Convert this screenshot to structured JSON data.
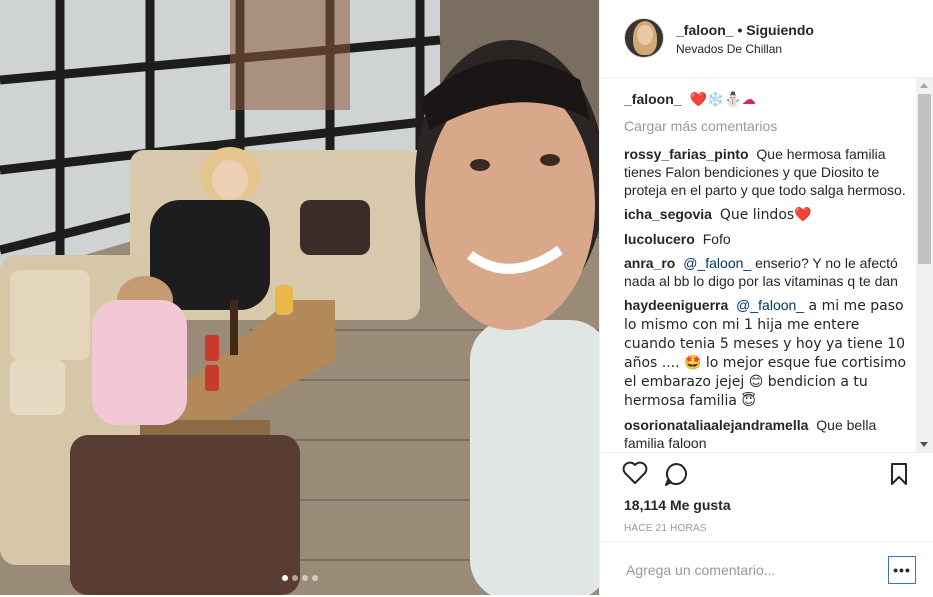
{
  "post": {
    "username": "_faloon_",
    "follow_status": "Siguiendo",
    "location": "Nevados De Chillan",
    "likes": "18,114 Me gusta",
    "time": "HACE 21 HORAS",
    "add_comment_placeholder": "Agrega un comentario...",
    "more_label": "•••"
  },
  "caption": {
    "user": "_faloon_",
    "text": "❤️❄️⛄☁"
  },
  "load_more": "Cargar más comentarios",
  "comments": [
    {
      "user": "rossy_farias_pinto",
      "text": "Que hermosa familia tienes Falon bendiciones y que Diosito te proteja en el parto y que todo salga hermoso.",
      "mention": ""
    },
    {
      "user": "icha_segovia",
      "text": "Que lindos❤️",
      "mention": ""
    },
    {
      "user": "lucolucero",
      "text": "Fofo",
      "mention": ""
    },
    {
      "user": "anra_ro",
      "mention": "@_faloon_",
      "text": " enserio? Y no le afectó nada al bb lo digo por las vitaminas q te dan"
    },
    {
      "user": "haydeeniguerra",
      "mention": "@_faloon_",
      "text": " a mi me paso lo mismo con mi 1 hija me entere cuando tenia 5 meses y hoy ya tiene 10 años .... 🤩 lo mejor esque fue cortisimo el embarazo jejej 😊 bendicion a tu hermosa familia 😇"
    },
    {
      "user": "osorionataliaalejandramella",
      "text": "Que bella familia faloon",
      "mention": ""
    }
  ],
  "colors": {
    "accent": "#3f73b5",
    "muted": "#999999",
    "text": "#262626"
  }
}
